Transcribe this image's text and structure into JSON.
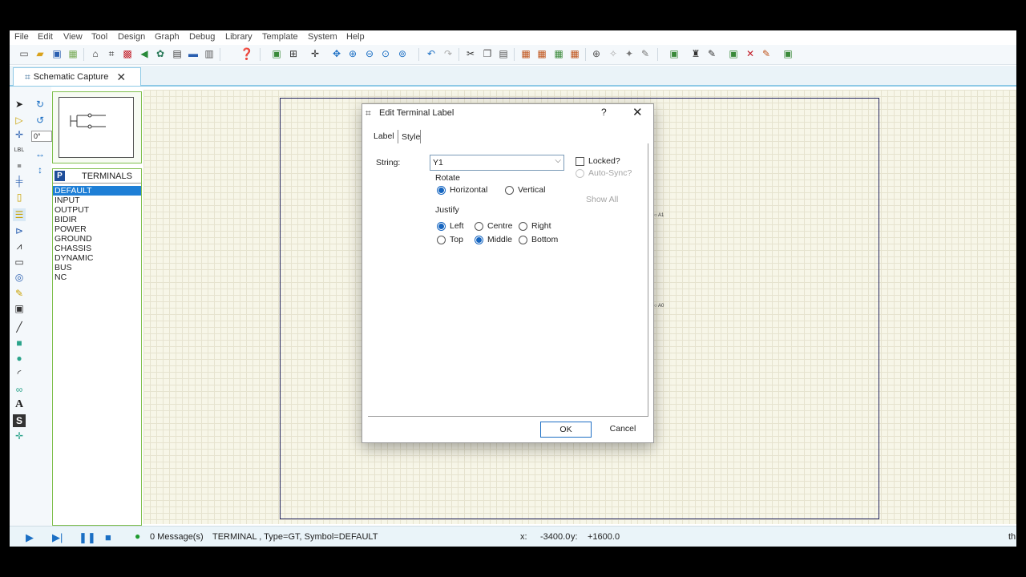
{
  "menu": [
    "File",
    "Edit",
    "View",
    "Tool",
    "Design",
    "Graph",
    "Debug",
    "Library",
    "Template",
    "System",
    "Help"
  ],
  "tab": {
    "label": "Schematic Capture",
    "close": "✕"
  },
  "left_tools": {
    "angle": "0°"
  },
  "selector": {
    "picker_letter": "P",
    "title": "TERMINALS",
    "items": [
      "DEFAULT",
      "INPUT",
      "OUTPUT",
      "BIDIR",
      "POWER",
      "GROUND",
      "CHASSIS",
      "DYNAMIC",
      "BUS",
      "NC"
    ],
    "selected": "DEFAULT"
  },
  "canvas": {
    "pins": [
      "A1",
      "A0"
    ]
  },
  "dialog": {
    "title": "Edit Terminal Label",
    "help": "?",
    "close": "✕",
    "tabs": [
      "Label",
      "Style"
    ],
    "string_label": "String:",
    "string_value": "Y1",
    "rotate_label": "Rotate",
    "rotate_options": [
      "Horizontal",
      "Vertical"
    ],
    "rotate_selected": "Horizontal",
    "justify_label": "Justify",
    "justify_row1": [
      "Left",
      "Centre",
      "Right"
    ],
    "justify_row2": [
      "Top",
      "Middle",
      "Bottom"
    ],
    "justify_h_selected": "Left",
    "justify_v_selected": "Middle",
    "locked_label": "Locked?",
    "locked": false,
    "autosync_label": "Auto-Sync?",
    "show_all_label": "Show All",
    "ok_label": "OK",
    "cancel_label": "Cancel"
  },
  "status": {
    "messages": "0 Message(s)",
    "info": "TERMINAL , Type=GT, Symbol=DEFAULT",
    "x_label": "x:",
    "x_value": "-3400.0",
    "y_label": "y:",
    "y_value": "+1600.0",
    "trailing": "th"
  }
}
